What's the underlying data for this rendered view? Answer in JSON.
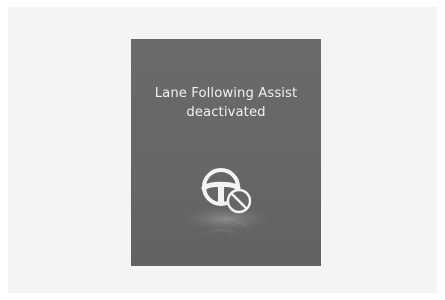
{
  "notification": {
    "line1": "Lane Following Assist",
    "line2": "deactivated",
    "icon": "steering-wheel-off-icon"
  },
  "colors": {
    "page_background": "#f3f4f3",
    "panel_background": "#666666",
    "text": "#f1f1f1",
    "icon": "#f4f4f4"
  }
}
